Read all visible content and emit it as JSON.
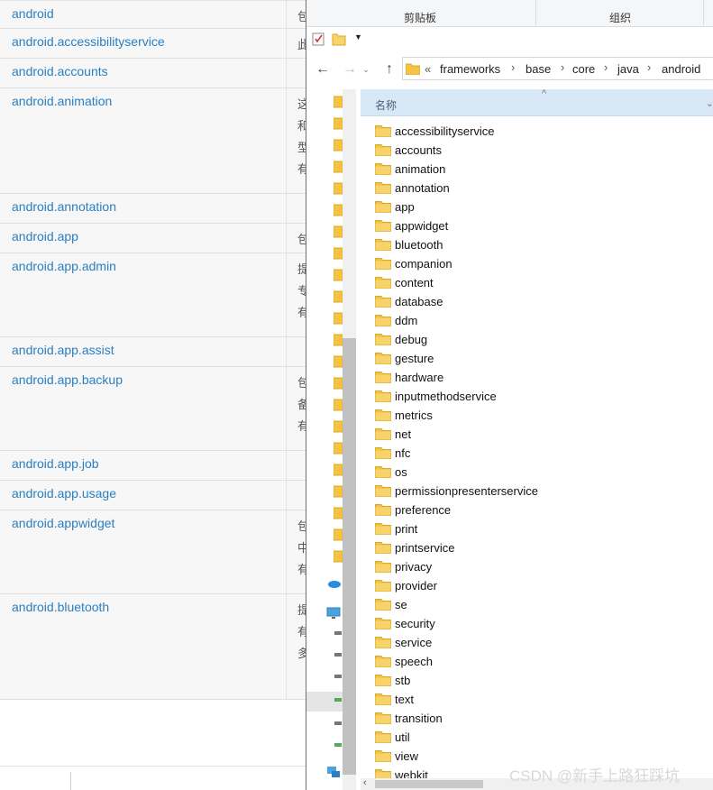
{
  "background_page": {
    "packages": [
      {
        "name": "android",
        "desc": [
          "包"
        ]
      },
      {
        "name": "android.accessibilityservice",
        "desc": [
          "此"
        ]
      },
      {
        "name": "android.accounts",
        "desc": []
      },
      {
        "name": "android.animation",
        "desc": [
          "这",
          "和",
          "型",
          "",
          "有"
        ]
      },
      {
        "name": "android.annotation",
        "desc": []
      },
      {
        "name": "android.app",
        "desc": [
          "包"
        ]
      },
      {
        "name": "android.app.admin",
        "desc": [
          "提",
          "专",
          "",
          "有"
        ]
      },
      {
        "name": "android.app.assist",
        "desc": []
      },
      {
        "name": "android.app.backup",
        "desc": [
          "包",
          "备",
          "",
          "有"
        ]
      },
      {
        "name": "android.app.job",
        "desc": []
      },
      {
        "name": "android.app.usage",
        "desc": []
      },
      {
        "name": "android.appwidget",
        "desc": [
          "包",
          "中",
          "",
          "有"
        ]
      },
      {
        "name": "android.bluetooth",
        "desc": [
          "提",
          "",
          "",
          "有",
          "多"
        ]
      }
    ]
  },
  "explorer": {
    "ribbon": {
      "clipboard_label": "剪贴板",
      "organize_label": "组织"
    },
    "address_bar": {
      "overflow": "«",
      "crumbs": [
        "frameworks",
        "base",
        "core",
        "java",
        "android"
      ]
    },
    "column_header": {
      "name_label": "名称"
    },
    "folders": [
      "accessibilityservice",
      "accounts",
      "animation",
      "annotation",
      "app",
      "appwidget",
      "bluetooth",
      "companion",
      "content",
      "database",
      "ddm",
      "debug",
      "gesture",
      "hardware",
      "inputmethodservice",
      "metrics",
      "net",
      "nfc",
      "os",
      "permissionpresenterservice",
      "preference",
      "print",
      "printservice",
      "privacy",
      "provider",
      "se",
      "security",
      "service",
      "speech",
      "stb",
      "text",
      "transition",
      "util",
      "view",
      "webkit"
    ],
    "folder_color": "#f5c342"
  },
  "watermark": "CSDN @新手上路狂踩坑",
  "colors": {
    "link": "#2a7fc0",
    "header_bg": "#d9e8f7",
    "ribbon_bg": "#f5f6f7"
  }
}
